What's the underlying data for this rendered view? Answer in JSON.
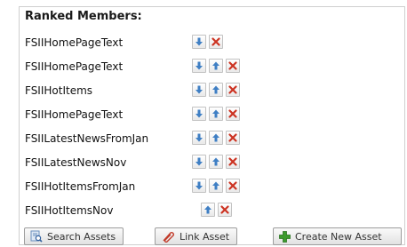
{
  "heading": "Ranked Members:",
  "members": [
    {
      "name": "FSIIHomePageText",
      "controls": [
        "move-down",
        "remove"
      ]
    },
    {
      "name": "FSIIHomePageText",
      "controls": [
        "move-down",
        "move-up",
        "remove"
      ]
    },
    {
      "name": "FSIIHotItems",
      "controls": [
        "move-down",
        "move-up",
        "remove"
      ]
    },
    {
      "name": "FSIIHomePageText",
      "controls": [
        "move-down",
        "move-up",
        "remove"
      ]
    },
    {
      "name": "FSIILatestNewsFromJan",
      "controls": [
        "move-down",
        "move-up",
        "remove"
      ]
    },
    {
      "name": "FSIILatestNewsNov",
      "controls": [
        "move-down",
        "move-up",
        "remove"
      ]
    },
    {
      "name": "FSIIHotItemsFromJan",
      "controls": [
        "move-down",
        "move-up",
        "remove"
      ]
    },
    {
      "name": "FSIIHotItemsNov",
      "controls": [
        "move-up",
        "remove"
      ]
    }
  ],
  "buttons": {
    "search_assets": "Search Assets",
    "link_asset": "Link Asset",
    "create_new_asset": "Create New Asset"
  },
  "colors": {
    "arrow": "#3f7fc4",
    "remove": "#cc3322",
    "create_plus": "#3d9a2e",
    "paperclip": "#c23b2a"
  },
  "icons": {
    "move_down": "down-arrow-icon",
    "move_up": "up-arrow-icon",
    "remove": "remove-x-icon",
    "search": "search-assets-icon",
    "link": "paperclip-icon",
    "create": "plus-icon"
  }
}
